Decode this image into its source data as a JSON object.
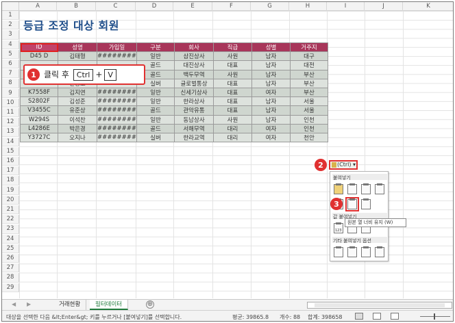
{
  "columns": [
    "A",
    "B",
    "C",
    "D",
    "E",
    "F",
    "G",
    "H",
    "I",
    "J",
    "K"
  ],
  "rows": [
    "1",
    "2",
    "3",
    "4",
    "5",
    "6",
    "7",
    "8",
    "9",
    "10",
    "11",
    "12",
    "13",
    "14",
    "15",
    "16",
    "17",
    "18",
    "19",
    "20",
    "21",
    "22",
    "23",
    "24",
    "25",
    "26",
    "27",
    "28",
    "29"
  ],
  "title": "등급 조정 대상 회원",
  "table": {
    "headers": [
      "ID",
      "성명",
      "가입일",
      "구분",
      "회사",
      "직급",
      "성별",
      "거주지"
    ],
    "rows": [
      [
        "D45  D",
        "김태형",
        "########",
        "일반",
        "삼진상사",
        "사원",
        "남자",
        "대구"
      ],
      [
        "",
        "",
        "",
        "골드",
        "대진상사",
        "대표",
        "남자",
        "대전"
      ],
      [
        "",
        "",
        "",
        "골드",
        "백두무역",
        "사원",
        "남자",
        "부산"
      ],
      [
        "K9277R",
        "한상호",
        "########",
        "실버",
        "글로벌통상",
        "대표",
        "남자",
        "부산"
      ],
      [
        "K7558F",
        "김지연",
        "########",
        "일반",
        "신세기상사",
        "대표",
        "여자",
        "부산"
      ],
      [
        "S2802F",
        "김성준",
        "########",
        "일반",
        "한라상사",
        "대표",
        "남자",
        "서울"
      ],
      [
        "V3455C",
        "유준상",
        "########",
        "골드",
        "관악유통",
        "대표",
        "남자",
        "서울"
      ],
      [
        "W294S",
        "이석찬",
        "########",
        "일반",
        "동남상사",
        "사원",
        "남자",
        "인천"
      ],
      [
        "L4286E",
        "박은경",
        "########",
        "골드",
        "서해무역",
        "대리",
        "여자",
        "인천"
      ],
      [
        "Y3727C",
        "오지나",
        "########",
        "실버",
        "한라교역",
        "대리",
        "여자",
        "천안"
      ]
    ]
  },
  "callout1": {
    "num": "1",
    "text": "클릭 후",
    "key1": "Ctrl",
    "plus": "+",
    "key2": "V"
  },
  "callout2_num": "2",
  "callout3_num": "3",
  "ctrl_tag": "(Ctrl) ▾",
  "paste_menu": {
    "section1": "붙여넣기",
    "section2": "값 붙여넣기",
    "section3": "기타 붙여넣기 옵션",
    "value_icon_label": "123"
  },
  "tooltip": "원본 열 너비 유지 (W)",
  "sheet_tabs": [
    "거래현황",
    "필터데이터"
  ],
  "add_sheet": "⊕",
  "nav_left": "◀",
  "nav_right": "▶",
  "status": {
    "message": "대상을 선택한 다음 &lt;Enter&gt; 키를 누르거나 [붙여넣기]를 선택합니다.",
    "average": "평균: 39865.8",
    "count": "개수: 88",
    "sum": "합계: 398658"
  }
}
